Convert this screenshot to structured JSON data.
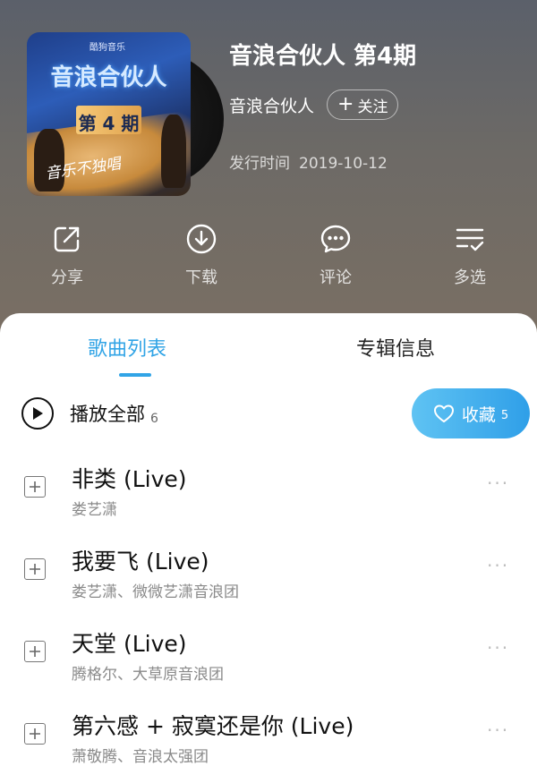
{
  "album": {
    "title": "音浪合伙人 第4期",
    "artist": "音浪合伙人",
    "follow_label": "关注",
    "release_label": "发行时间",
    "release_date": "2019-10-12",
    "cover": {
      "brand": "酷狗音乐",
      "show_title": "音浪合伙人",
      "episode": "第 4 期",
      "script": "音乐不独唱"
    }
  },
  "actions": [
    {
      "label": "分享",
      "icon": "share-icon"
    },
    {
      "label": "下载",
      "icon": "download-icon"
    },
    {
      "label": "评论",
      "icon": "comment-icon"
    },
    {
      "label": "多选",
      "icon": "multi-select-icon"
    }
  ],
  "tabs": {
    "songs": "歌曲列表",
    "info": "专辑信息"
  },
  "play_all": {
    "label": "播放全部",
    "count": "6"
  },
  "collect": {
    "label": "收藏",
    "count": "5"
  },
  "songs": [
    {
      "title": "非类 (Live)",
      "singer": "娄艺潇"
    },
    {
      "title": "我要飞 (Live)",
      "singer": "娄艺潇、微微艺潇音浪团"
    },
    {
      "title": "天堂 (Live)",
      "singer": "腾格尔、大草原音浪团"
    },
    {
      "title": "第六感 + 寂寞还是你 (Live)",
      "singer": "萧敬腾、音浪太强团"
    }
  ],
  "more_glyph": "···",
  "colors": {
    "accent": "#31a4e6",
    "collect_start": "#5fc3f3",
    "collect_end": "#2f9fe8"
  }
}
